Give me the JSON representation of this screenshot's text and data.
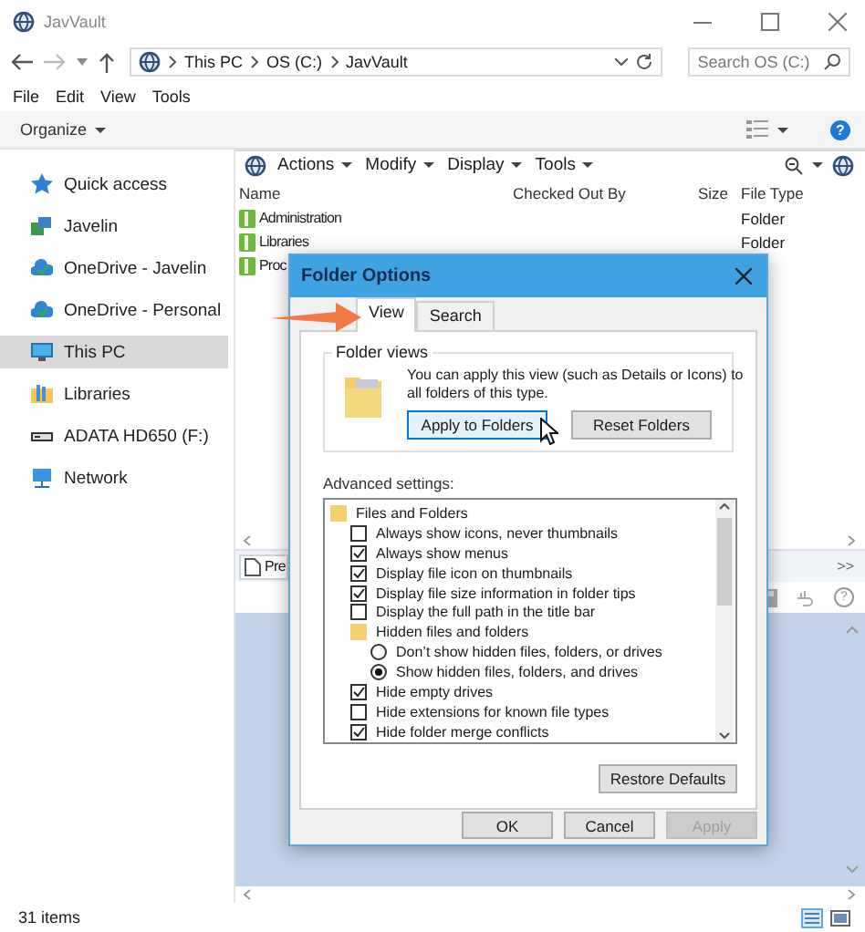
{
  "window": {
    "title": "JavVault"
  },
  "address": {
    "path": [
      "This PC",
      "OS (C:)",
      "JavVault"
    ],
    "search_placeholder": "Search OS (C:)"
  },
  "menu": [
    "File",
    "Edit",
    "View",
    "Tools"
  ],
  "command_bar": {
    "organize": "Organize",
    "help": "?"
  },
  "nav": [
    {
      "label": "Quick access",
      "kind": "star",
      "selected": false
    },
    {
      "label": "Javelin",
      "kind": "vault",
      "selected": false
    },
    {
      "label": "OneDrive - Javelin",
      "kind": "cloud",
      "selected": false
    },
    {
      "label": "OneDrive - Personal",
      "kind": "cloud",
      "selected": false
    },
    {
      "label": "This PC",
      "kind": "monitor",
      "selected": true
    },
    {
      "label": "Libraries",
      "kind": "library",
      "selected": false
    },
    {
      "label": "ADATA HD650 (F:)",
      "kind": "drive",
      "selected": false
    },
    {
      "label": "Network",
      "kind": "network",
      "selected": false
    }
  ],
  "vault_toolbar": [
    "Actions",
    "Modify",
    "Display",
    "Tools"
  ],
  "file_list": {
    "columns": [
      "Name",
      "Checked Out By",
      "Size",
      "File Type"
    ],
    "rows": [
      {
        "name": "Administration",
        "file_type": "Folder"
      },
      {
        "name": "Libraries",
        "file_type": "Folder"
      },
      {
        "name": "Proc"
      }
    ]
  },
  "preview": {
    "tab": "Pre",
    "more": ">>",
    "help": "?"
  },
  "status_bar": {
    "count": "31 items"
  },
  "dialog": {
    "title": "Folder Options",
    "tabs": [
      {
        "label": "View",
        "selected": true
      },
      {
        "label": "Search",
        "selected": false
      }
    ],
    "group_title": "Folder views",
    "description": "You can apply this view (such as Details or Icons) to all folders of this type.",
    "view_buttons": [
      {
        "label": "Apply to Folders",
        "hovered": true
      },
      {
        "label": "Reset Folders",
        "hovered": false
      }
    ],
    "advanced_label": "Advanced settings:",
    "settings": [
      {
        "kind": "folder",
        "label": "Files and Folders",
        "children": [
          {
            "kind": "checkbox",
            "label": "Always show icons, never thumbnails",
            "checked": false
          },
          {
            "kind": "checkbox",
            "label": "Always show menus",
            "checked": true
          },
          {
            "kind": "checkbox",
            "label": "Display file icon on thumbnails",
            "checked": true
          },
          {
            "kind": "checkbox",
            "label": "Display file size information in folder tips",
            "checked": true
          },
          {
            "kind": "checkbox",
            "label": "Display the full path in the title bar",
            "checked": false
          },
          {
            "kind": "folder",
            "label": "Hidden files and folders",
            "children": [
              {
                "kind": "radio",
                "label": "Don’t show hidden files, folders, or drives",
                "selected": false
              },
              {
                "kind": "radio",
                "label": "Show hidden files, folders, and drives",
                "selected": true
              }
            ]
          },
          {
            "kind": "checkbox",
            "label": "Hide empty drives",
            "checked": true
          },
          {
            "kind": "checkbox",
            "label": "Hide extensions for known file types",
            "checked": false
          },
          {
            "kind": "checkbox",
            "label": "Hide folder merge conflicts",
            "checked": true
          }
        ]
      }
    ],
    "restore": "Restore Defaults",
    "buttons": [
      {
        "label": "OK",
        "disabled": false
      },
      {
        "label": "Cancel",
        "disabled": false
      },
      {
        "label": "Apply",
        "disabled": true
      }
    ]
  }
}
